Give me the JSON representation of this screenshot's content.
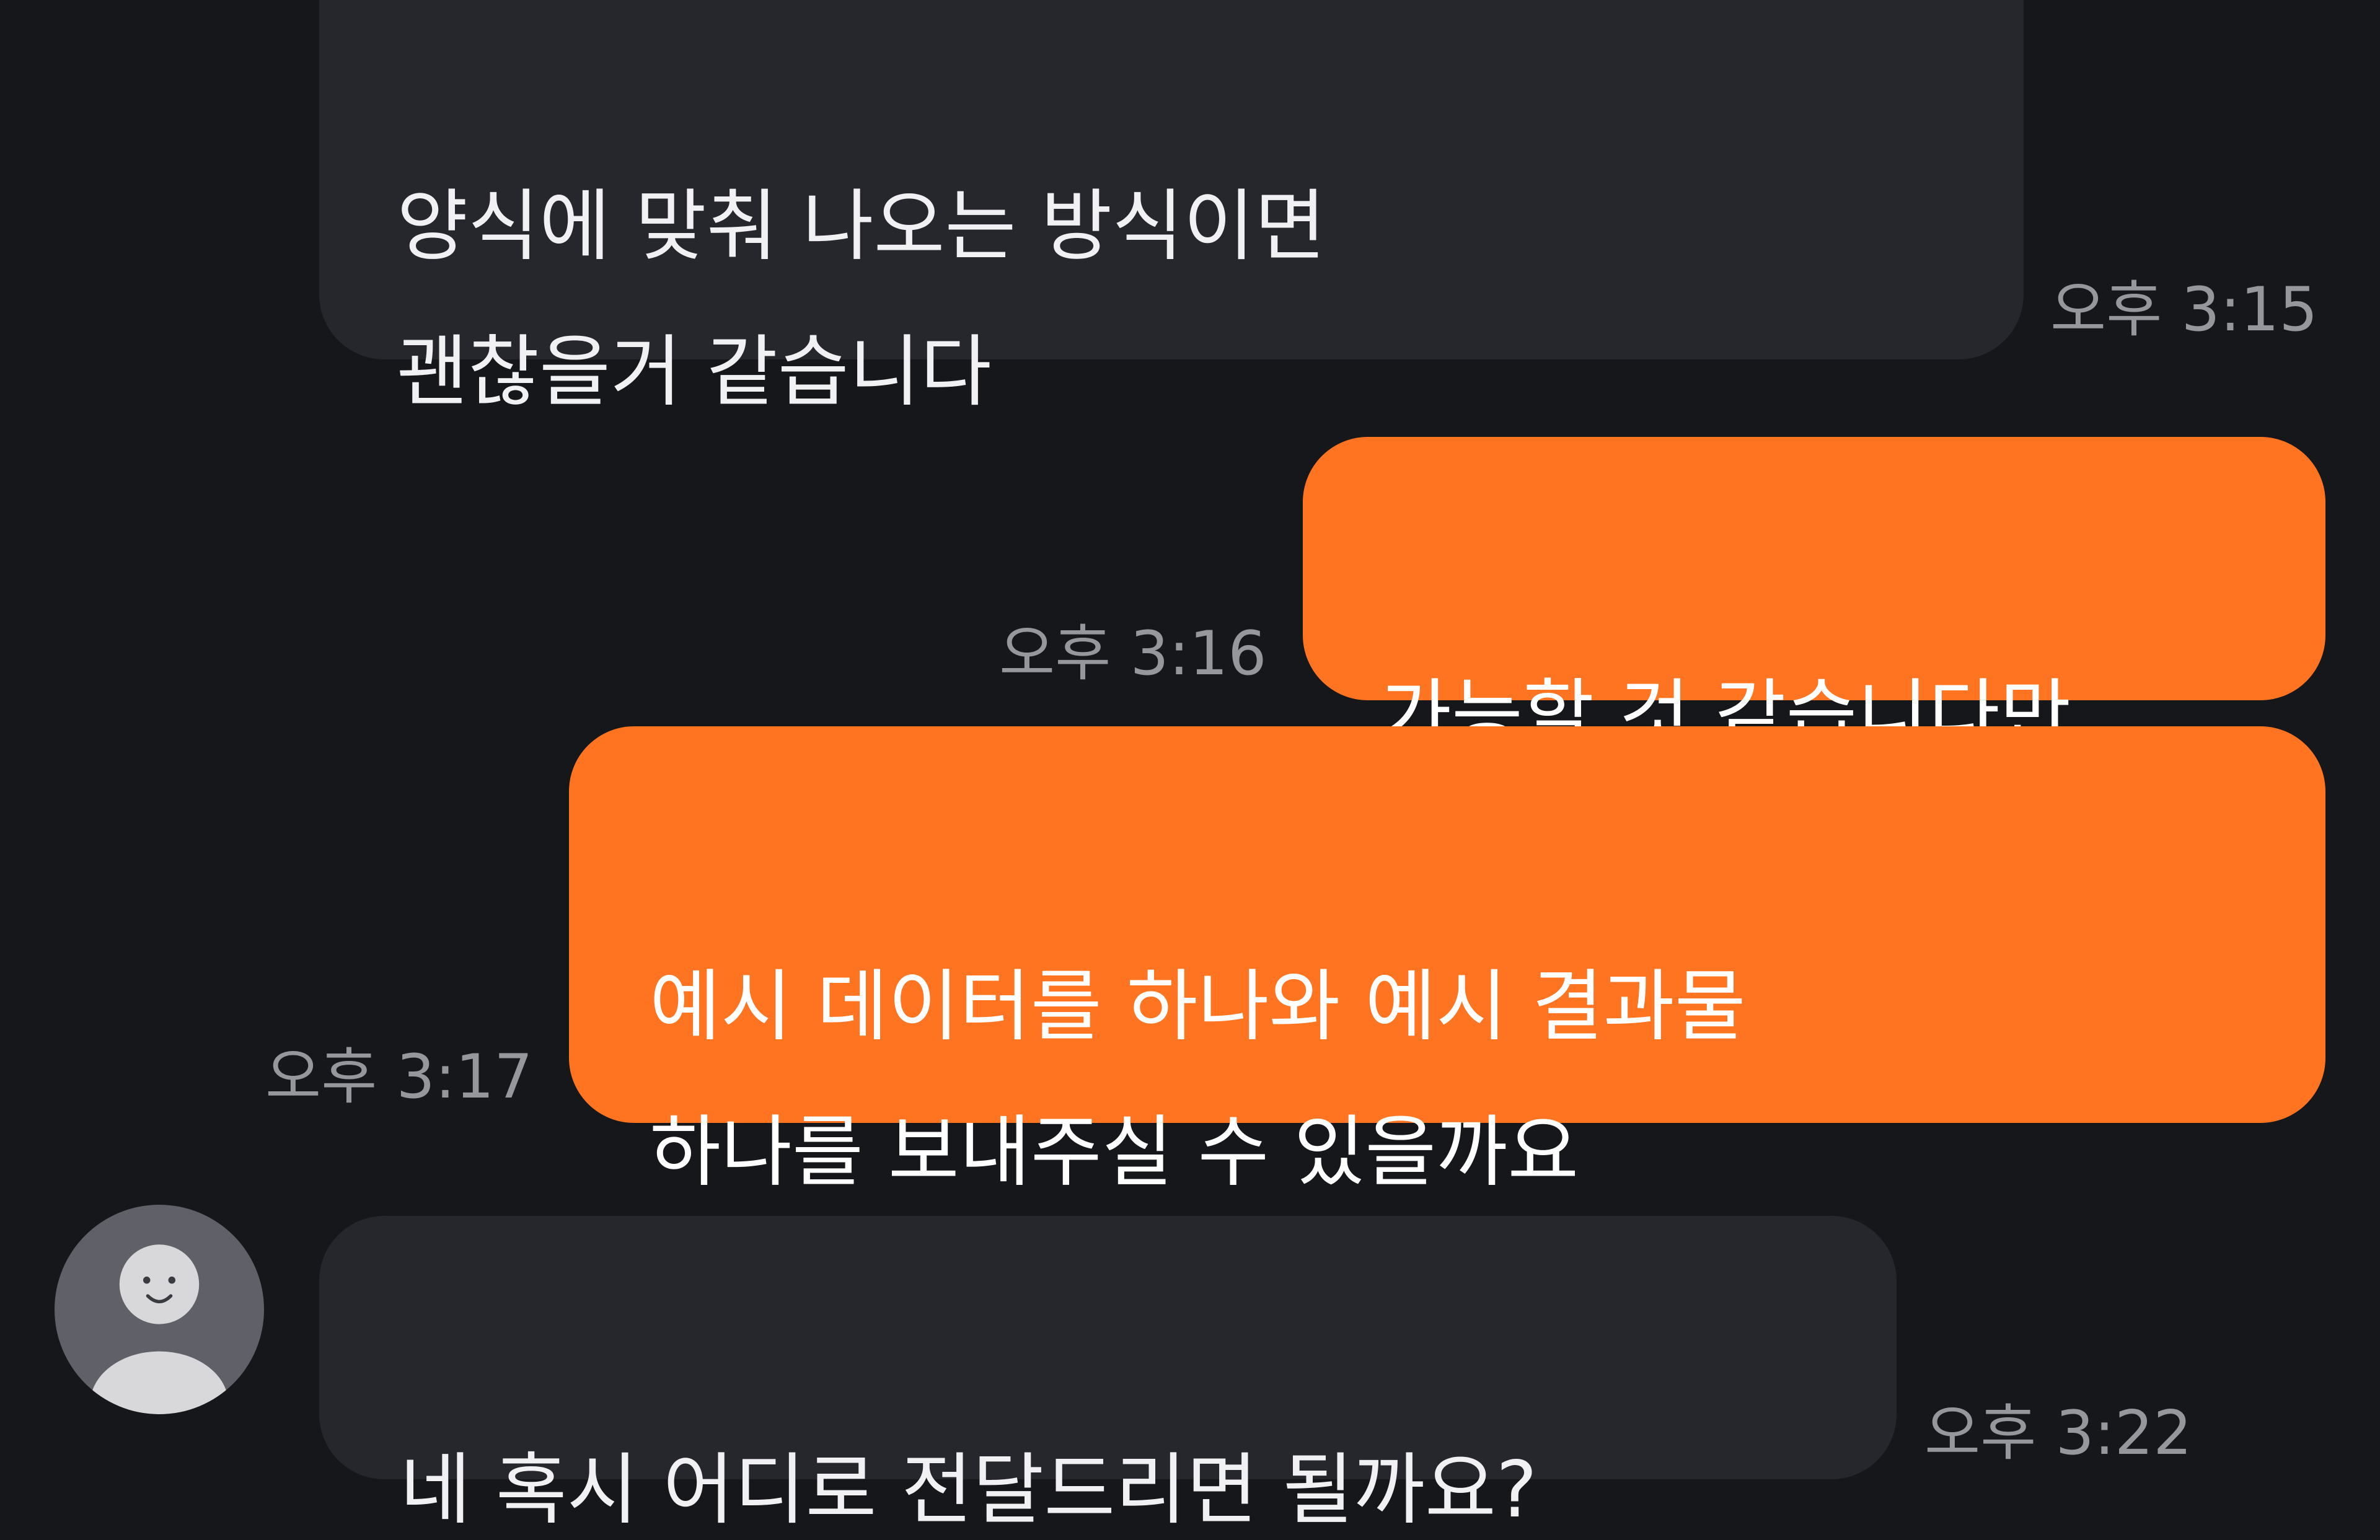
{
  "messages": [
    {
      "direction": "incoming",
      "text": "양식에 맞춰 나오는 방식이면\n괜찮을거 같습니다",
      "time": "오후 3:15"
    },
    {
      "direction": "outgoing",
      "text": "가능할 것 같습니다만",
      "time": "오후 3:16"
    },
    {
      "direction": "outgoing",
      "text": "예시 데이터를 하나와 예시 결과물\n하나를 보내주실 수 있을까요",
      "time": "오후 3:17"
    },
    {
      "direction": "incoming",
      "text": "네 혹시 어디로 전달드리면 될까요?",
      "time": "오후 3:22"
    }
  ],
  "avatar": {
    "icon": "default-profile-icon"
  },
  "colors": {
    "background": "#16171b",
    "incoming_bubble": "#25272c",
    "outgoing_bubble": "#ff7420",
    "timestamp": "#96979c",
    "avatar_bg": "#606168",
    "avatar_figure": "#d8d8da"
  }
}
